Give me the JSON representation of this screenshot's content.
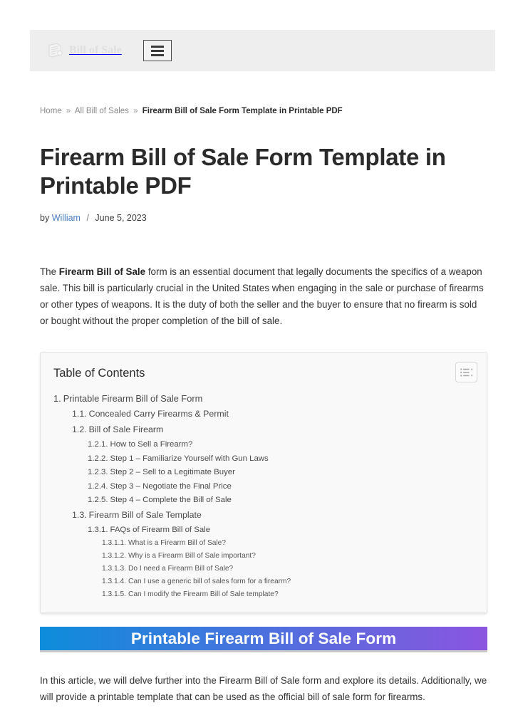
{
  "header": {
    "brand_name": "Bill of Sale",
    "brand_icon": "document-icon",
    "menu_icon": "hamburger-menu-icon"
  },
  "breadcrumb": {
    "home": "Home",
    "separator": "»",
    "category": "All Bill of Sales",
    "current": "Firearm Bill of Sale Form Template in Printable PDF"
  },
  "article": {
    "title": "Firearm Bill of Sale Form Template in Printable PDF",
    "byline_prefix": "by",
    "author": "William",
    "byline_separator": "/",
    "date": "June 5, 2023",
    "intro_before": "The ",
    "intro_bold": "Firearm Bill of Sale",
    "intro_after": " form is an essential document that legally documents the specifics of a weapon sale. This bill is particularly crucial in the United States when engaging in the sale or purchase of firearms or other types of weapons. It is the duty of both the seller and the buyer to ensure that no firearm is sold or bought without the proper completion of the bill of sale.",
    "outro": "In this article, we will delve further into the Firearm Bill of Sale form and explore its details. Additionally, we will provide a printable template that can be used as the official bill of sale form for firearms."
  },
  "toc": {
    "title": "Table of Contents",
    "toggle_icon": "list-toggle-icon",
    "items": [
      {
        "number": "1.",
        "label": "Printable Firearm Bill of Sale Form",
        "level": 1
      },
      {
        "number": "1.1.",
        "label": "Concealed Carry Firearms & Permit",
        "level": 2
      },
      {
        "number": "1.2.",
        "label": "Bill of Sale Firearm",
        "level": 2
      },
      {
        "number": "1.2.1.",
        "label": "How to Sell a Firearm?",
        "level": 3
      },
      {
        "number": "1.2.2.",
        "label": "Step 1 – Familiarize Yourself with Gun Laws",
        "level": 3
      },
      {
        "number": "1.2.3.",
        "label": "Step 2 – Sell to a Legitimate Buyer",
        "level": 3
      },
      {
        "number": "1.2.4.",
        "label": "Step 3 – Negotiate the Final Price",
        "level": 3
      },
      {
        "number": "1.2.5.",
        "label": "Step 4 – Complete the Bill of Sale",
        "level": 3
      },
      {
        "number": "1.3.",
        "label": "Firearm Bill of Sale Template",
        "level": 2
      },
      {
        "number": "1.3.1.",
        "label": "FAQs of Firearm Bill of Sale",
        "level": 3
      },
      {
        "number": "1.3.1.1.",
        "label": "What is a Firearm Bill of Sale?",
        "level": 4
      },
      {
        "number": "1.3.1.2.",
        "label": "Why is a Firearm Bill of Sale important?",
        "level": 4
      },
      {
        "number": "1.3.1.3.",
        "label": "Do I need a Firearm Bill of Sale?",
        "level": 4
      },
      {
        "number": "1.3.1.4.",
        "label": "Can I use a generic bill of sales form for a firearm?",
        "level": 4
      },
      {
        "number": "1.3.1.5.",
        "label": "Can I modify the Firearm Bill of Sale template?",
        "level": 4
      }
    ]
  },
  "banner": {
    "text": "Printable Firearm Bill of Sale Form",
    "gradient_start": "#0d8ddb",
    "gradient_end": "#8b55e0",
    "text_color": "#ffffff"
  },
  "colors": {
    "header_bg": "#eeeeee",
    "page_bg": "#ffffff",
    "link": "#4a7fc1",
    "toc_bg": "#f9f9f9",
    "body_text": "#333333"
  }
}
